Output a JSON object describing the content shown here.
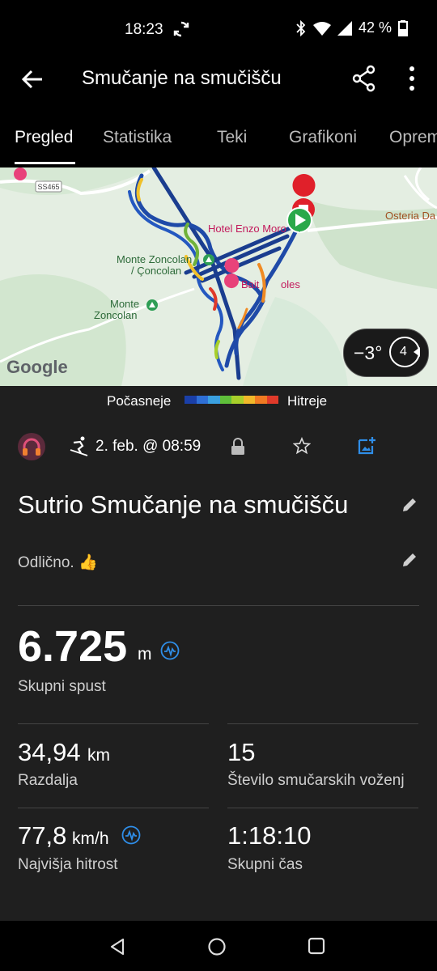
{
  "status_bar": {
    "time": "18:23",
    "battery": "42 %"
  },
  "header": {
    "title": "Smučanje na smučišču"
  },
  "tabs": [
    {
      "label": "Pregled",
      "active": true
    },
    {
      "label": "Statistika"
    },
    {
      "label": "Teki"
    },
    {
      "label": "Grafikoni"
    },
    {
      "label": "Opreme"
    }
  ],
  "map": {
    "labels": {
      "ss465": "SS465",
      "hotel": "Hotel Enzo Moro",
      "osteria": "Osteria Da",
      "zoncolan1_line1": "Monte Zoncolan",
      "zoncolan1_line2": "/ Çoncolan",
      "bait": "Bait",
      "bait_suffix": "oles",
      "zoncolan2_line1": "Monte",
      "zoncolan2_line2": "Zoncolan",
      "google": "Google"
    },
    "temperature": "−3°",
    "wind": "4",
    "route_color": "#1a3d8f"
  },
  "legend": {
    "slower": "Počasneje",
    "faster": "Hitreje",
    "colors": [
      "#1a3fa8",
      "#2e6fd6",
      "#3aa0e0",
      "#5fbf3a",
      "#a8cf2a",
      "#f0b82a",
      "#f07a22",
      "#e03a2a"
    ]
  },
  "meta": {
    "date": "2. feb. @ 08:59"
  },
  "activity": {
    "title": "Sutrio Smučanje na smučišču",
    "note": "Odlično. 👍"
  },
  "stats": {
    "descent": {
      "value": "6.725",
      "unit": "m",
      "label": "Skupni spust"
    },
    "distance": {
      "value": "34,94",
      "unit": "km",
      "label": "Razdalja"
    },
    "runs": {
      "value": "15",
      "label": "Število smučarskih voženj"
    },
    "max_speed": {
      "value": "77,8",
      "unit": "km/h",
      "label": "Najvišja hitrost"
    },
    "total_time": {
      "value": "1:18:10",
      "label": "Skupni čas"
    }
  }
}
